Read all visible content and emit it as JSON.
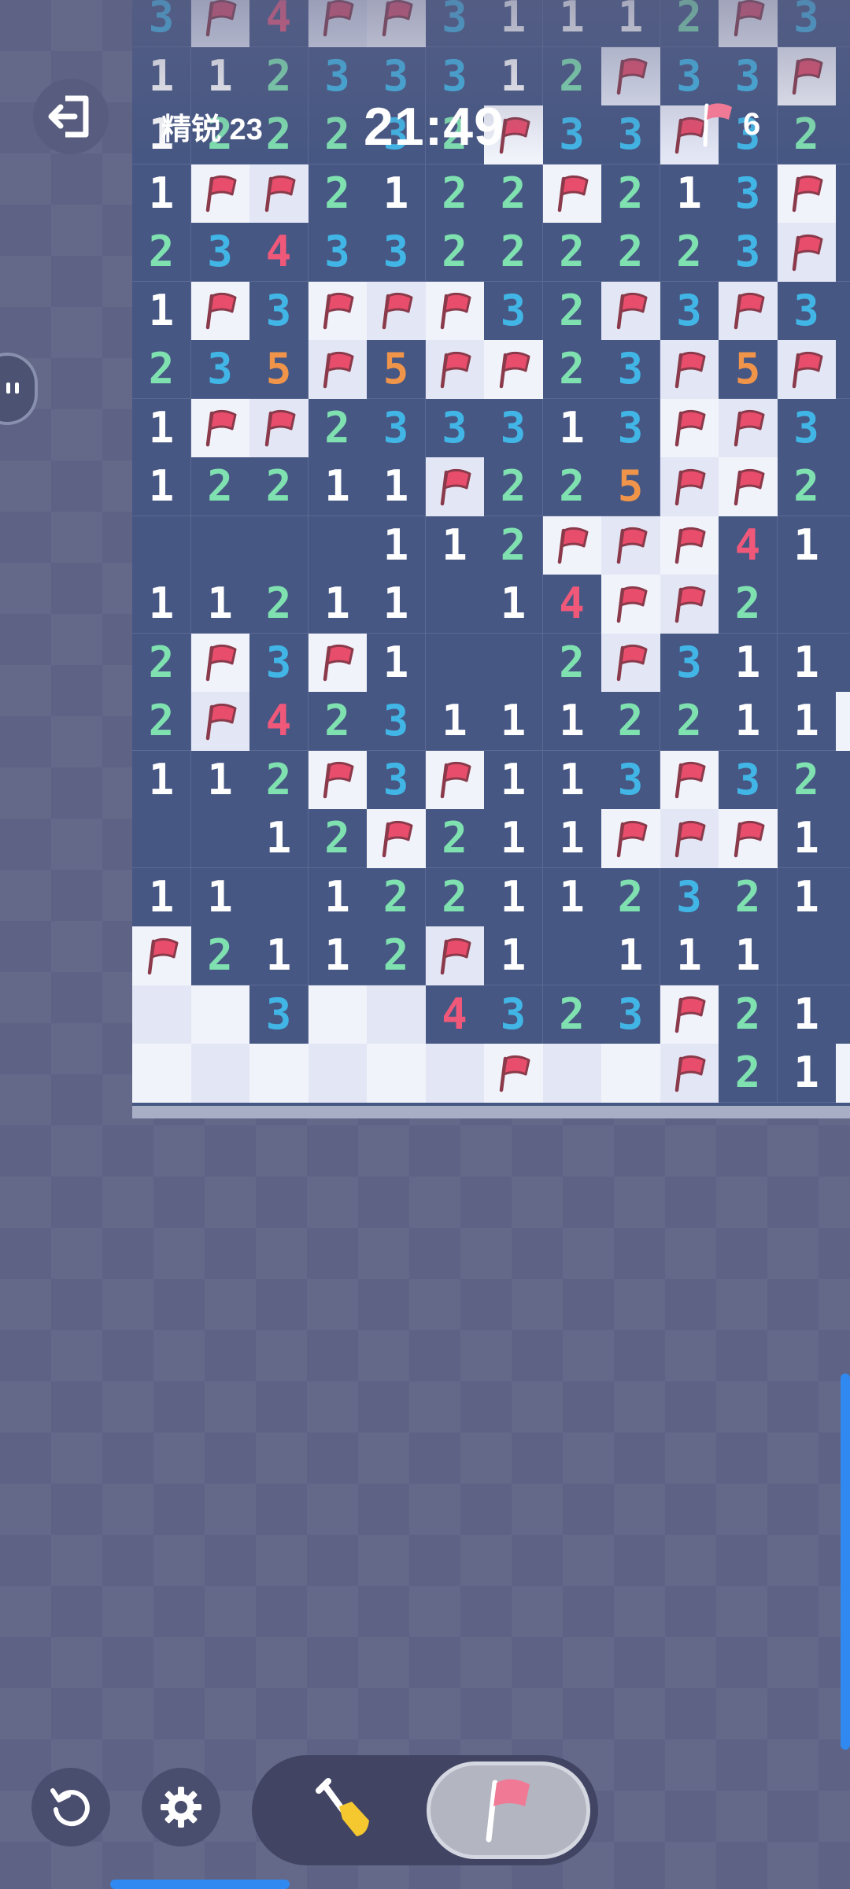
{
  "hud": {
    "level_label": "精锐 23",
    "timer": "21:49",
    "flags_remaining": "6"
  },
  "colors": {
    "1": "#ffffff",
    "2": "#7fe0b0",
    "3": "#41b6e6",
    "4": "#f0587a",
    "5": "#f0944a",
    "flag": "#e84d6c"
  },
  "board": {
    "cols": 13,
    "rows": 19,
    "grid": [
      [
        "3",
        "F",
        "4",
        "F",
        "F",
        "3",
        "1",
        "1",
        "1",
        "2",
        "F",
        "3",
        "."
      ],
      [
        "1",
        "1",
        "2",
        "3",
        "3",
        "3",
        "1",
        "2",
        "F",
        "3",
        "3",
        "F",
        "."
      ],
      [
        "1",
        "2",
        "2",
        "2",
        "3",
        "2",
        "F",
        "3",
        "3",
        "F",
        "3",
        "2",
        "."
      ],
      [
        "1",
        "F",
        "F",
        "2",
        "1",
        "2",
        "2",
        "F",
        "2",
        "1",
        "3",
        "F",
        "."
      ],
      [
        "2",
        "3",
        "4",
        "3",
        "3",
        "2",
        "2",
        "2",
        "2",
        "2",
        "3",
        "F",
        "."
      ],
      [
        "1",
        "F",
        "3",
        "F",
        "F",
        "F",
        "3",
        "2",
        "F",
        "3",
        "F",
        "3",
        "."
      ],
      [
        "2",
        "3",
        "5",
        "F",
        "5",
        "F",
        "F",
        "2",
        "3",
        "F",
        "5",
        "F",
        "."
      ],
      [
        "1",
        "F",
        "F",
        "2",
        "3",
        "3",
        "3",
        "1",
        "3",
        "F",
        "F",
        "3",
        "."
      ],
      [
        "1",
        "2",
        "2",
        "1",
        "1",
        "F",
        "2",
        "2",
        "5",
        "F",
        "F",
        "2",
        "."
      ],
      [
        ".",
        ".",
        ".",
        ".",
        "1",
        "1",
        "2",
        "F",
        "F",
        "F",
        "4",
        "1",
        "."
      ],
      [
        "1",
        "1",
        "2",
        "1",
        "1",
        ".",
        "1",
        "4",
        "F",
        "F",
        "2",
        ".",
        "."
      ],
      [
        "2",
        "F",
        "3",
        "F",
        "1",
        ".",
        ".",
        "2",
        "F",
        "3",
        "1",
        "1",
        "."
      ],
      [
        "2",
        "F",
        "4",
        "2",
        "3",
        "1",
        "1",
        "1",
        "2",
        "2",
        "1",
        "1",
        "H"
      ],
      [
        "1",
        "1",
        "2",
        "F",
        "3",
        "F",
        "1",
        "1",
        "3",
        "F",
        "3",
        "2",
        "."
      ],
      [
        ".",
        ".",
        "1",
        "2",
        "F",
        "2",
        "1",
        "1",
        "F",
        "F",
        "F",
        "1",
        "."
      ],
      [
        "1",
        "1",
        ".",
        "1",
        "2",
        "2",
        "1",
        "1",
        "2",
        "3",
        "2",
        "1",
        "."
      ],
      [
        "F",
        "2",
        "1",
        "1",
        "2",
        "F",
        "1",
        ".",
        "1",
        "1",
        "1",
        ".",
        "."
      ],
      [
        "H",
        "H",
        "3",
        "H",
        "H",
        "4",
        "3",
        "2",
        "3",
        "F",
        "2",
        "1",
        "."
      ],
      [
        "H",
        "H",
        "H",
        "H",
        "H",
        "H",
        "F",
        "H",
        "H",
        "F",
        "2",
        "1",
        "H"
      ]
    ]
  }
}
